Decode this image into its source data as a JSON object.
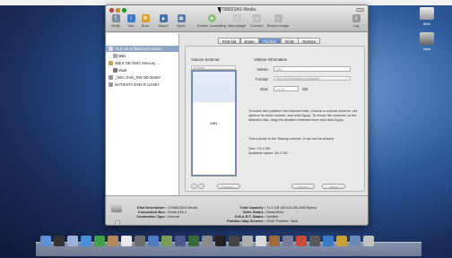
{
  "window": {
    "title": "ST98823AS Media"
  },
  "toolbar": {
    "items": [
      "Verify",
      "Info",
      "Burn",
      "Mount",
      "Eject",
      "Enable Journaling",
      "New Image",
      "Convert",
      "Resize Image"
    ],
    "log": "Log"
  },
  "sidebar": {
    "items": [
      "74.5 GB ST98823AS Media",
      "MB1",
      "465.8 GB OWC Mercury ...",
      "Vault",
      "_NEC DVD_RW ND-3540A",
      "MATSHITA DVD-R UJ-857"
    ]
  },
  "tabs": [
    "First Aid",
    "Erase",
    "Partition",
    "RAID",
    "Restore"
  ],
  "partition": {
    "volume_scheme_label": "Volume Scheme:",
    "volume_scheme_value": "Current",
    "volume_info_label": "Volume Information",
    "name_label": "Name:",
    "name_value": "MB1",
    "format_label": "Format:",
    "format_value": "Mac OS Extended (Journaled)",
    "size_label": "Size:",
    "size_value": "74.09",
    "size_unit": "GB",
    "volume_block_label": "MB1",
    "info_paragraph1": "To erase and partition the selected disk, choose a volume scheme, set options for each volume, and click Apply. To resize the volumes on the selected disk, drag the dividers between them and click Apply.",
    "info_paragraph2": "This volume is the Startup volume, it can not be erased.",
    "info_size": "Size: 74.1 GB",
    "info_available": "Available space: 48.1 GB",
    "options_button": "Options...",
    "revert_button": "Revert",
    "apply_button": "Apply"
  },
  "disk_info": {
    "left": [
      {
        "k": "Disk Description :",
        "v": "ST98823AS Media"
      },
      {
        "k": "Connection Bus :",
        "v": "Serial ATA 2"
      },
      {
        "k": "Connection Type :",
        "v": "Internal"
      }
    ],
    "right": [
      {
        "k": "Total Capacity :",
        "v": "74.5 GB (80,026,361,856 Bytes)"
      },
      {
        "k": "Write Status :",
        "v": "Read/Write"
      },
      {
        "k": "S.M.A.R.T. Status :",
        "v": "Verified"
      },
      {
        "k": "Partition Map Scheme :",
        "v": "GUID Partition Table"
      }
    ]
  },
  "desktop": {
    "icons": [
      "MB1",
      "Vault"
    ]
  },
  "colors": {
    "selection": "#8ea6c6",
    "active_tab": "#5f86c2",
    "close": "#e0443e",
    "minimize": "#dea123",
    "zoom": "#1aab29"
  }
}
